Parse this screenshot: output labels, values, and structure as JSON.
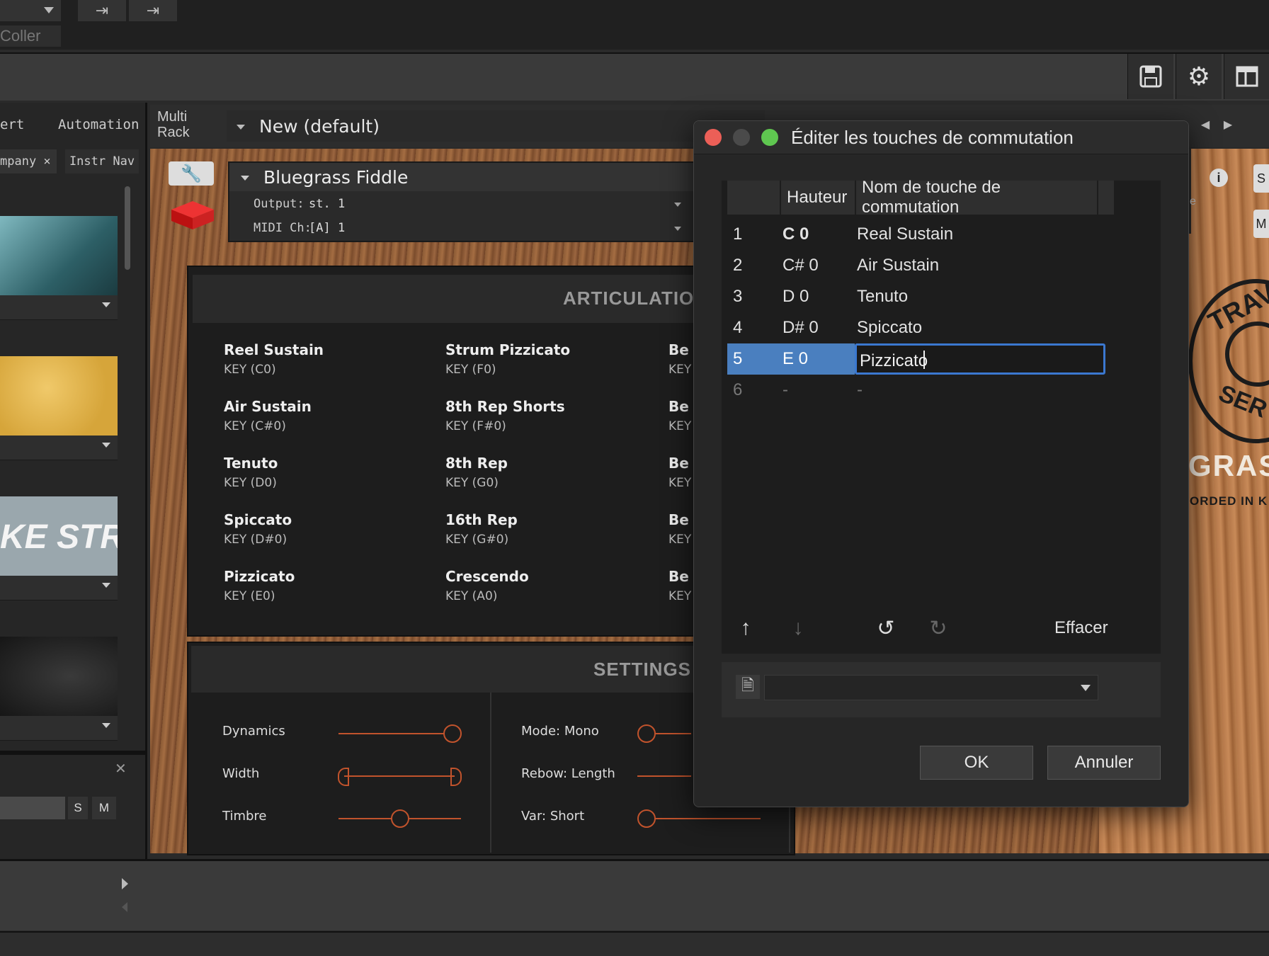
{
  "host": {
    "top_left_label": "Coller",
    "transport": [
      "⇥",
      "⇥"
    ],
    "tools": [
      "save-icon",
      "gear-icon",
      "layout-icon"
    ]
  },
  "browser": {
    "tabs": [
      "ert",
      "Automation"
    ],
    "filter_tabs": [
      "mpany ×",
      "Instr Nav"
    ],
    "thumb_text": "KE STRI",
    "mixer_buttons": [
      "S",
      "M"
    ]
  },
  "rack": {
    "label_line1": "Multi",
    "label_line2": "Rack",
    "preset": "New (default)"
  },
  "instrument": {
    "name": "Bluegrass Fiddle",
    "output_label": "Output:",
    "output_value": "st. 1",
    "midi_label": "MIDI Ch:",
    "midi_value": "[A]  1",
    "articulations_heading": "ARTICULATIO",
    "articulations": [
      {
        "name": "Reel Sustain",
        "key": "KEY (C0)"
      },
      {
        "name": "Air Sustain",
        "key": "KEY (C#0)"
      },
      {
        "name": "Tenuto",
        "key": "KEY (D0)"
      },
      {
        "name": "Spiccato",
        "key": "KEY (D#0)"
      },
      {
        "name": "Pizzicato",
        "key": "KEY (E0)"
      },
      {
        "name": "Strum Pizzicato",
        "key": "KEY (F0)"
      },
      {
        "name": "8th Rep Shorts",
        "key": "KEY (F#0)"
      },
      {
        "name": "8th Rep",
        "key": "KEY (G0)"
      },
      {
        "name": "16th Rep",
        "key": "KEY (G#0)"
      },
      {
        "name": "Crescendo",
        "key": "KEY (A0)"
      },
      {
        "name": "Be",
        "key": "KEY"
      },
      {
        "name": "Be",
        "key": "KEY"
      },
      {
        "name": "Be",
        "key": "KEY"
      },
      {
        "name": "Be",
        "key": "KEY"
      },
      {
        "name": "Be",
        "key": "KEY"
      }
    ],
    "settings_heading": "SETTINGS",
    "settings_left": [
      "Dynamics",
      "Width",
      "Timbre"
    ],
    "settings_right": [
      "Mode: Mono",
      "Rebow: Length",
      "Var: Short"
    ],
    "side_text": [
      "GRAS",
      "ORDED IN K",
      "TRAV",
      "SER"
    ],
    "side_label_e": "e",
    "side_buttons": [
      "S",
      "M"
    ]
  },
  "dialog": {
    "title": "Éditer les touches de commutation",
    "col_pitch": "Hauteur",
    "col_name": "Nom de touche de commutation",
    "rows": [
      {
        "n": "1",
        "pitch": "C 0",
        "name": "Real Sustain"
      },
      {
        "n": "2",
        "pitch": "C# 0",
        "name": "Air Sustain"
      },
      {
        "n": "3",
        "pitch": "D 0",
        "name": "Tenuto"
      },
      {
        "n": "4",
        "pitch": "D# 0",
        "name": "Spiccato"
      },
      {
        "n": "5",
        "pitch": "E 0",
        "name": "Pizzicato"
      },
      {
        "n": "6",
        "pitch": "-",
        "name": "-"
      }
    ],
    "clear_label": "Effacer",
    "ok_label": "OK",
    "cancel_label": "Annuler",
    "colors": {
      "selected": "#4a7fbf",
      "accent": "#3b78d0"
    }
  }
}
